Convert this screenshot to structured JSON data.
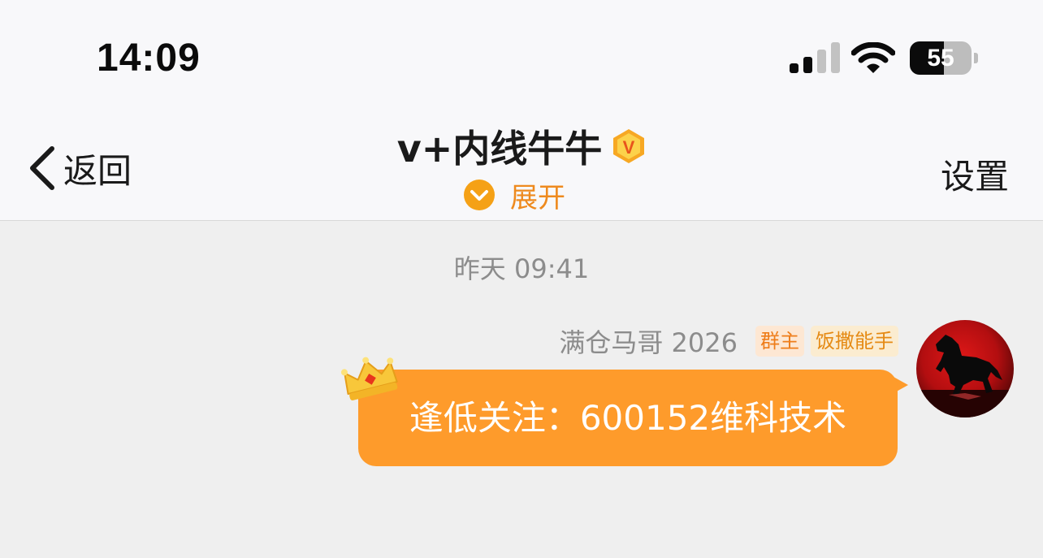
{
  "status_bar": {
    "time": "14:09",
    "battery_level": "55",
    "battery_percent": 55,
    "signal_bars_active": 2,
    "signal_bars_total": 4
  },
  "nav": {
    "back_label": "返回",
    "title": "v+内线牛牛",
    "verified_badge_letter": "V",
    "expand_label": "展开",
    "settings_label": "设置"
  },
  "chat": {
    "timestamp": "昨天 09:41",
    "message": {
      "sender_name": "满仓马哥 2026",
      "tags": [
        "群主",
        "饭撒能手"
      ],
      "text": "逢低关注：600152维科技术"
    }
  },
  "icons": {
    "back": "chevron-left-icon",
    "verified": "v-badge-icon",
    "expand": "chevron-down-circle-icon",
    "crown": "crown-icon",
    "signal": "signal-icon",
    "wifi": "wifi-icon",
    "battery": "battery-icon",
    "avatar": "horse-avatar"
  },
  "colors": {
    "accent": "#ee8a1e",
    "bubble": "#fe9b2b",
    "tag_owner_bg": "#fde7d3",
    "tag_title_bg": "#fbecd0",
    "background": "#efefef",
    "header_bg": "#f8f8fa"
  }
}
